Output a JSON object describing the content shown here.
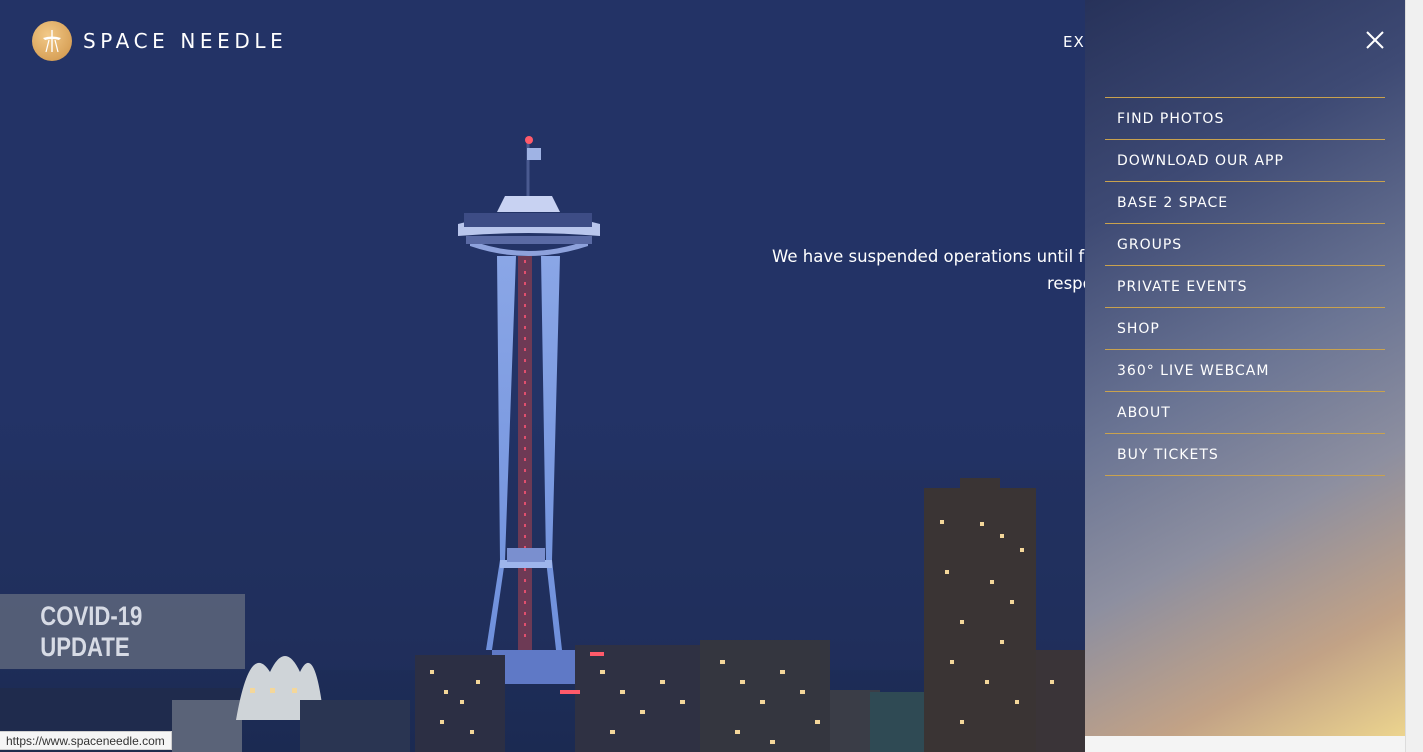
{
  "header": {
    "brand": "SPACE NEEDLE",
    "nav_peek": "EX"
  },
  "hero": {
    "message_line1": "We have suspended operations until fur",
    "message_line2": "respo"
  },
  "covid_badge": {
    "label": "COVID-19 UPDATE"
  },
  "status_bar": {
    "url": "https://www.spaceneedle.com"
  },
  "menu": {
    "close_icon": "close-icon",
    "items": [
      {
        "label": "FIND PHOTOS"
      },
      {
        "label": "DOWNLOAD OUR APP"
      },
      {
        "label": "BASE 2 SPACE"
      },
      {
        "label": "GROUPS"
      },
      {
        "label": "PRIVATE EVENTS"
      },
      {
        "label": "SHOP"
      },
      {
        "label": "360° LIVE WEBCAM"
      },
      {
        "label": "ABOUT"
      },
      {
        "label": "BUY TICKETS"
      }
    ]
  },
  "colors": {
    "sky": "#233366",
    "accent_gold": "#c9a24e",
    "logo_gold": "#d9a35a"
  }
}
